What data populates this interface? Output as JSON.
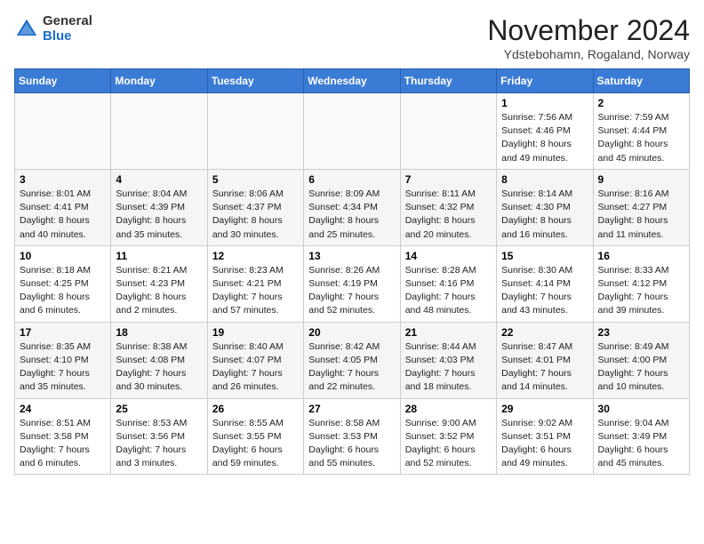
{
  "header": {
    "logo_general": "General",
    "logo_blue": "Blue",
    "month_title": "November 2024",
    "location": "Ydstebohamn, Rogaland, Norway"
  },
  "weekdays": [
    "Sunday",
    "Monday",
    "Tuesday",
    "Wednesday",
    "Thursday",
    "Friday",
    "Saturday"
  ],
  "weeks": [
    [
      {
        "day": "",
        "info": ""
      },
      {
        "day": "",
        "info": ""
      },
      {
        "day": "",
        "info": ""
      },
      {
        "day": "",
        "info": ""
      },
      {
        "day": "",
        "info": ""
      },
      {
        "day": "1",
        "info": "Sunrise: 7:56 AM\nSunset: 4:46 PM\nDaylight: 8 hours and 49 minutes."
      },
      {
        "day": "2",
        "info": "Sunrise: 7:59 AM\nSunset: 4:44 PM\nDaylight: 8 hours and 45 minutes."
      }
    ],
    [
      {
        "day": "3",
        "info": "Sunrise: 8:01 AM\nSunset: 4:41 PM\nDaylight: 8 hours and 40 minutes."
      },
      {
        "day": "4",
        "info": "Sunrise: 8:04 AM\nSunset: 4:39 PM\nDaylight: 8 hours and 35 minutes."
      },
      {
        "day": "5",
        "info": "Sunrise: 8:06 AM\nSunset: 4:37 PM\nDaylight: 8 hours and 30 minutes."
      },
      {
        "day": "6",
        "info": "Sunrise: 8:09 AM\nSunset: 4:34 PM\nDaylight: 8 hours and 25 minutes."
      },
      {
        "day": "7",
        "info": "Sunrise: 8:11 AM\nSunset: 4:32 PM\nDaylight: 8 hours and 20 minutes."
      },
      {
        "day": "8",
        "info": "Sunrise: 8:14 AM\nSunset: 4:30 PM\nDaylight: 8 hours and 16 minutes."
      },
      {
        "day": "9",
        "info": "Sunrise: 8:16 AM\nSunset: 4:27 PM\nDaylight: 8 hours and 11 minutes."
      }
    ],
    [
      {
        "day": "10",
        "info": "Sunrise: 8:18 AM\nSunset: 4:25 PM\nDaylight: 8 hours and 6 minutes."
      },
      {
        "day": "11",
        "info": "Sunrise: 8:21 AM\nSunset: 4:23 PM\nDaylight: 8 hours and 2 minutes."
      },
      {
        "day": "12",
        "info": "Sunrise: 8:23 AM\nSunset: 4:21 PM\nDaylight: 7 hours and 57 minutes."
      },
      {
        "day": "13",
        "info": "Sunrise: 8:26 AM\nSunset: 4:19 PM\nDaylight: 7 hours and 52 minutes."
      },
      {
        "day": "14",
        "info": "Sunrise: 8:28 AM\nSunset: 4:16 PM\nDaylight: 7 hours and 48 minutes."
      },
      {
        "day": "15",
        "info": "Sunrise: 8:30 AM\nSunset: 4:14 PM\nDaylight: 7 hours and 43 minutes."
      },
      {
        "day": "16",
        "info": "Sunrise: 8:33 AM\nSunset: 4:12 PM\nDaylight: 7 hours and 39 minutes."
      }
    ],
    [
      {
        "day": "17",
        "info": "Sunrise: 8:35 AM\nSunset: 4:10 PM\nDaylight: 7 hours and 35 minutes."
      },
      {
        "day": "18",
        "info": "Sunrise: 8:38 AM\nSunset: 4:08 PM\nDaylight: 7 hours and 30 minutes."
      },
      {
        "day": "19",
        "info": "Sunrise: 8:40 AM\nSunset: 4:07 PM\nDaylight: 7 hours and 26 minutes."
      },
      {
        "day": "20",
        "info": "Sunrise: 8:42 AM\nSunset: 4:05 PM\nDaylight: 7 hours and 22 minutes."
      },
      {
        "day": "21",
        "info": "Sunrise: 8:44 AM\nSunset: 4:03 PM\nDaylight: 7 hours and 18 minutes."
      },
      {
        "day": "22",
        "info": "Sunrise: 8:47 AM\nSunset: 4:01 PM\nDaylight: 7 hours and 14 minutes."
      },
      {
        "day": "23",
        "info": "Sunrise: 8:49 AM\nSunset: 4:00 PM\nDaylight: 7 hours and 10 minutes."
      }
    ],
    [
      {
        "day": "24",
        "info": "Sunrise: 8:51 AM\nSunset: 3:58 PM\nDaylight: 7 hours and 6 minutes."
      },
      {
        "day": "25",
        "info": "Sunrise: 8:53 AM\nSunset: 3:56 PM\nDaylight: 7 hours and 3 minutes."
      },
      {
        "day": "26",
        "info": "Sunrise: 8:55 AM\nSunset: 3:55 PM\nDaylight: 6 hours and 59 minutes."
      },
      {
        "day": "27",
        "info": "Sunrise: 8:58 AM\nSunset: 3:53 PM\nDaylight: 6 hours and 55 minutes."
      },
      {
        "day": "28",
        "info": "Sunrise: 9:00 AM\nSunset: 3:52 PM\nDaylight: 6 hours and 52 minutes."
      },
      {
        "day": "29",
        "info": "Sunrise: 9:02 AM\nSunset: 3:51 PM\nDaylight: 6 hours and 49 minutes."
      },
      {
        "day": "30",
        "info": "Sunrise: 9:04 AM\nSunset: 3:49 PM\nDaylight: 6 hours and 45 minutes."
      }
    ]
  ]
}
